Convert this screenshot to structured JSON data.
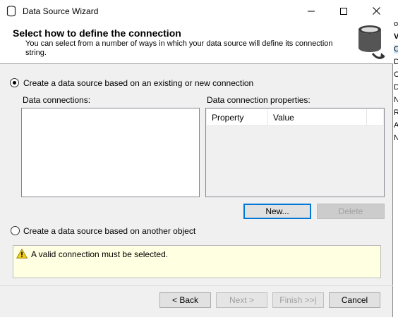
{
  "window": {
    "title": "Data Source Wizard",
    "minimize_icon": "minimize-icon",
    "maximize_icon": "maximize-icon",
    "close_icon": "close-icon"
  },
  "header": {
    "title": "Select how to define the connection",
    "description": "You can select from a number of ways in which your data source will define its connection string.",
    "logo_icon": "database-connection-icon"
  },
  "options": {
    "existing_connection": {
      "label": "Create a data source based on an existing or new connection",
      "selected": true
    },
    "another_object": {
      "label": "Create a data source based on another object",
      "selected": false
    }
  },
  "connections": {
    "label": "Data connections:",
    "items": []
  },
  "properties": {
    "label": "Data connection properties:",
    "columns": [
      "Property",
      "Value"
    ],
    "rows": []
  },
  "buttons": {
    "new": "New...",
    "delete": "Delete",
    "back": "< Back",
    "next": "Next >",
    "finish": "Finish >>|",
    "cancel": "Cancel"
  },
  "warning": {
    "icon": "warning-icon",
    "text": "A valid connection must be selected."
  },
  "background_window": {
    "clipped_chars": [
      "or",
      "VI",
      "C",
      "D",
      "C",
      "D",
      "N",
      "R",
      "A",
      "N"
    ]
  },
  "colors": {
    "focus_accent": "#0078d7",
    "warning_bg": "#ffffe1",
    "dialog_bg": "#f0f0f0"
  }
}
